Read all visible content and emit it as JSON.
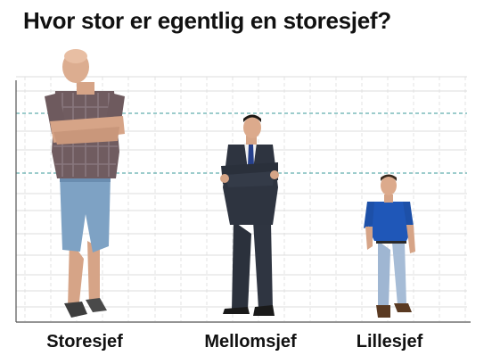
{
  "title": "Hvor stor er egentlig en storesjef?",
  "figures": [
    {
      "label": "Storesjef",
      "description": "bald man in plaid shirt and denim shorts, arms crossed",
      "colors": {
        "shirt": "#6f5b5e",
        "shorts": "#7fa3c4",
        "skin": "#d9a88c",
        "shoes": "#3e3e3e"
      }
    },
    {
      "label": "Mellomsjef",
      "description": "man in dark suit with blue tie, arms crossed",
      "colors": {
        "suit": "#2e3440",
        "shirt": "#f2f2f2",
        "tie": "#26408c",
        "skin": "#d6a587",
        "shoes": "#1a1a1a"
      }
    },
    {
      "label": "Lillesjef",
      "description": "short man in blue polo shirt and jeans",
      "colors": {
        "shirt": "#1f57b8",
        "jeans": "#9fb7d3",
        "skin": "#d9a88c",
        "shoes": "#5a3a22"
      }
    }
  ],
  "grid": {
    "line_color": "#d9d9d9",
    "accent_line_color": "#2f8f8f",
    "axis_color": "#555555"
  }
}
